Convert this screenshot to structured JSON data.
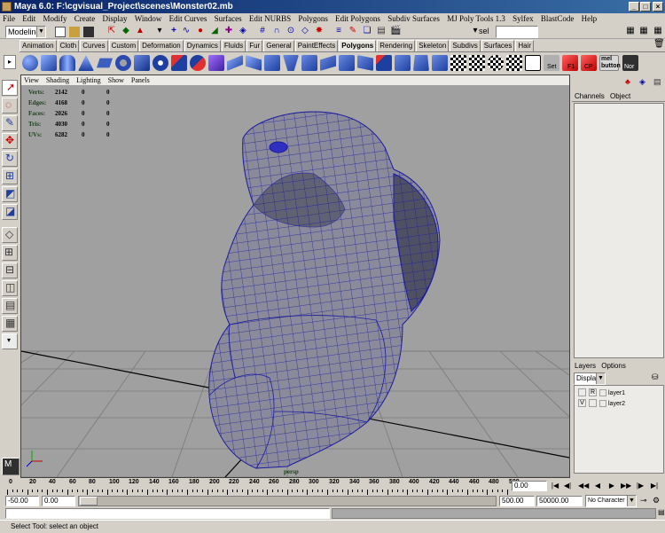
{
  "window": {
    "title": "Maya 6.0: F:\\cgvisual_Project\\scenes\\Monster02.mb",
    "minimize": "_",
    "maximize": "□",
    "close": "×"
  },
  "menubar": [
    "File",
    "Edit",
    "Modify",
    "Create",
    "Display",
    "Window",
    "Edit Curves",
    "Surfaces",
    "Edit NURBS",
    "Polygons",
    "Edit Polygons",
    "Subdiv Surfaces",
    "MJ Poly Tools 1.3",
    "Sylfex",
    "BlastCode",
    "Help"
  ],
  "status": {
    "mode": "Modeling",
    "selection_field": "sel"
  },
  "shelf_tabs": [
    "Animation",
    "Cloth",
    "Curves",
    "Custom",
    "Deformation",
    "Dynamics",
    "Fluids",
    "Fur",
    "General",
    "PaintEffects",
    "Polygons",
    "Rendering",
    "Skeleton",
    "Subdivs",
    "Surfaces",
    "Hair"
  ],
  "shelf_active_tab": "Polygons",
  "shelf_labels": [
    "Set",
    "F1",
    "CP",
    "mel button",
    "Nor"
  ],
  "viewport": {
    "menu": [
      "View",
      "Shading",
      "Lighting",
      "Show",
      "Panels"
    ],
    "hud": [
      {
        "label": "Verts:",
        "values": [
          "2142",
          "0",
          "0"
        ]
      },
      {
        "label": "Edges:",
        "values": [
          "4168",
          "0",
          "0"
        ]
      },
      {
        "label": "Faces:",
        "values": [
          "2026",
          "0",
          "0"
        ]
      },
      {
        "label": "Tris:",
        "values": [
          "4030",
          "0",
          "0"
        ]
      },
      {
        "label": "UVs:",
        "values": [
          "6282",
          "0",
          "0"
        ]
      }
    ],
    "camera": "persp",
    "background": "#a0a0a0",
    "wire_color": "#1a1aa0"
  },
  "channel_box": {
    "tabs": [
      "Channels",
      "Object"
    ]
  },
  "layers": {
    "tabs": [
      "Layers",
      "Options"
    ],
    "display_dropdown": "Display",
    "rows": [
      {
        "flag1": "",
        "flag2": "R",
        "name": "layer1"
      },
      {
        "flag1": "V",
        "flag2": "",
        "name": "layer2"
      }
    ]
  },
  "time_slider": {
    "ticks": [
      "0",
      "20",
      "40",
      "60",
      "80",
      "100",
      "120",
      "140",
      "160",
      "180",
      "200",
      "220",
      "240",
      "260",
      "280",
      "300",
      "320",
      "340",
      "360",
      "380",
      "400",
      "420",
      "440",
      "460",
      "480",
      "500"
    ],
    "current_time": "0.00"
  },
  "range_slider": {
    "start": "-50.00",
    "inner_start": "0.00",
    "inner_end": "500.00",
    "end": "50000.00",
    "character_set": "No Character Set"
  },
  "help_line": "Select Tool: select an object"
}
